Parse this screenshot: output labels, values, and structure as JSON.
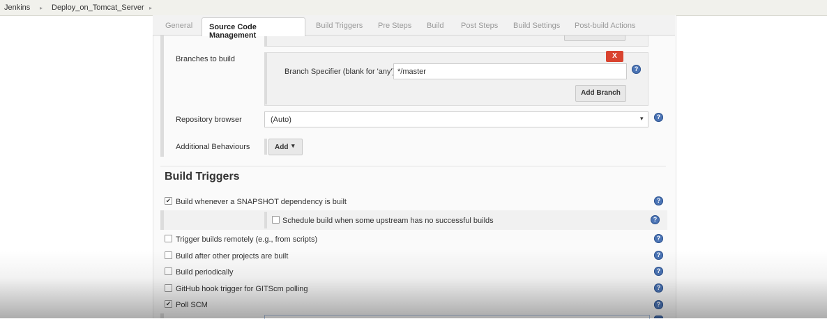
{
  "breadcrumb": [
    "Jenkins",
    "Deploy_on_Tomcat_Server"
  ],
  "tabs": [
    "General",
    "Source Code Management",
    "Build Triggers",
    "Pre Steps",
    "Build",
    "Post Steps",
    "Build Settings",
    "Post-build Actions"
  ],
  "scm": {
    "branches_label": "Branches to build",
    "delete_label": "X",
    "branch_specifier_label": "Branch Specifier (blank for 'any')",
    "branch_specifier_value": "*/master",
    "add_branch_label": "Add Branch",
    "repo_browser_label": "Repository browser",
    "repo_browser_value": "(Auto)",
    "additional_behaviours_label": "Additional Behaviours",
    "add_label": "Add"
  },
  "build_triggers": {
    "heading": "Build Triggers",
    "items": [
      {
        "label": "Build whenever a SNAPSHOT dependency is built",
        "checked": true
      },
      {
        "label": "Schedule build when some upstream has no successful builds",
        "checked": false
      },
      {
        "label": "Trigger builds remotely (e.g., from scripts)",
        "checked": false
      },
      {
        "label": "Build after other projects are built",
        "checked": false
      },
      {
        "label": "Build periodically",
        "checked": false
      },
      {
        "label": "GitHub hook trigger for GITScm polling",
        "checked": false
      },
      {
        "label": "Poll SCM",
        "checked": true
      }
    ]
  },
  "colors": {
    "accent": "#4b74b5",
    "delete": "#d9432f",
    "panel": "#fafafa"
  },
  "icons": {
    "help": "help-icon",
    "dropdown": "caret-down-icon",
    "breadcrumb_sep": "chevron-right-icon"
  }
}
